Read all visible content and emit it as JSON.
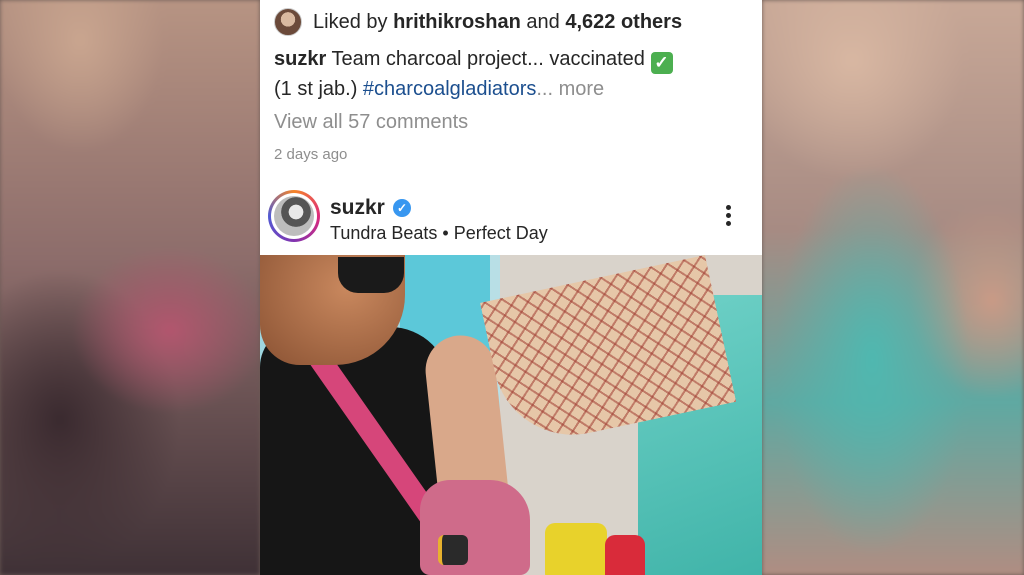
{
  "post": {
    "likes": {
      "prefix": "Liked by ",
      "liker": "hrithikroshan",
      "middle": " and ",
      "others": "4,622 others"
    },
    "caption": {
      "username": "suzkr",
      "text_line1": " Team charcoal project... vaccinated ",
      "check_mark": "✓",
      "text_line2": "(1 st jab.) ",
      "hashtag": "#charcoalgladiators",
      "more": "... more"
    },
    "comments_link": "View all 57 comments",
    "time_ago": "2 days ago"
  },
  "next_post": {
    "username": "suzkr",
    "verified_mark": "✓",
    "music": "Tundra Beats • Perfect Day"
  },
  "icons": {
    "liker_avatar": "avatar-icon",
    "verified": "verified-badge-icon",
    "options": "more-options-icon"
  },
  "colors": {
    "link_blue": "#1c4f8f",
    "verified_blue": "#3897f0",
    "muted_gray": "#8e8e8e",
    "text_dark": "#262626"
  }
}
